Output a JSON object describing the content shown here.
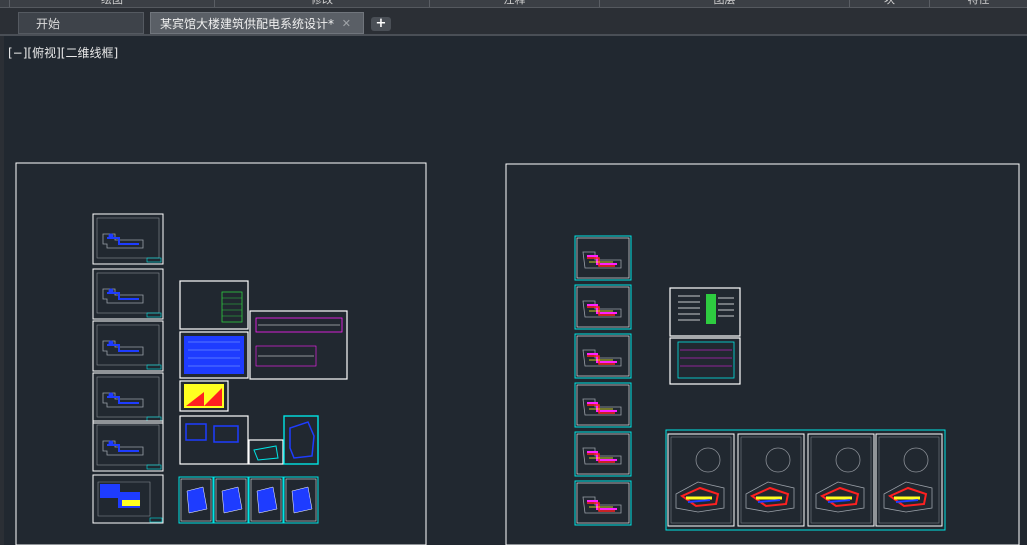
{
  "ribbon": {
    "panels": [
      "绘图",
      "修改",
      "注释",
      "图层",
      "块",
      "特性"
    ]
  },
  "tabs": {
    "start_label": "开始",
    "document_label": "某宾馆大楼建筑供配电系统设计*",
    "close_symbol": "✕",
    "add_symbol": "+"
  },
  "viewport": {
    "view_label": "[−][俯视][二维线框]"
  },
  "colors": {
    "background": "#212830",
    "sheet_border": "#ffffff",
    "highlight": "#00e5e5",
    "wiring_blue": "#1e3cff",
    "wiring_red": "#ff2020",
    "wiring_magenta": "#ff20ff",
    "wiring_yellow": "#ffff20"
  }
}
